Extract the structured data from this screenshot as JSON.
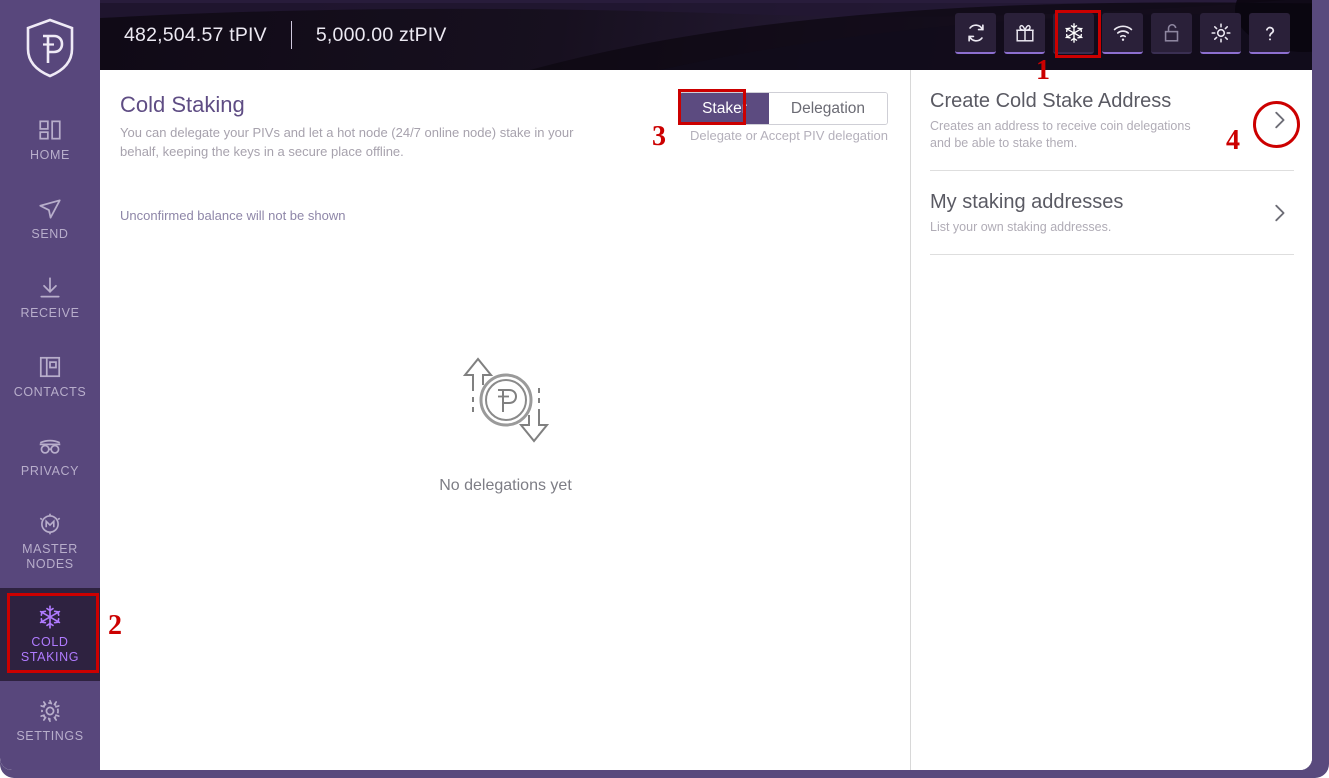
{
  "window": {
    "frame_color": "#594a7d",
    "sidebar_color": "#58477c",
    "accent_color": "#b07bff",
    "annotation_color": "#cc0000"
  },
  "sidebar": {
    "logo_name": "pivx-shield-logo",
    "items": [
      {
        "id": "home",
        "label": "HOME",
        "icon": "dashboard-icon",
        "active": false
      },
      {
        "id": "send",
        "label": "SEND",
        "icon": "send-icon",
        "active": false
      },
      {
        "id": "receive",
        "label": "RECEIVE",
        "icon": "receive-icon",
        "active": false
      },
      {
        "id": "contacts",
        "label": "CONTACTS",
        "icon": "contacts-icon",
        "active": false
      },
      {
        "id": "privacy",
        "label": "PRIVACY",
        "icon": "privacy-mask-icon",
        "active": false
      },
      {
        "id": "masternodes",
        "label": "MASTER\nNODES",
        "icon": "masternode-icon",
        "active": false
      },
      {
        "id": "coldstaking",
        "label": "COLD\nSTAKING",
        "icon": "snowflake-icon",
        "active": true
      },
      {
        "id": "settings",
        "label": "SETTINGS",
        "icon": "gear-icon",
        "active": false
      }
    ]
  },
  "header": {
    "balance_primary": "482,504.57 tPIV",
    "balance_secondary": "5,000.00 ztPIV",
    "toolbar": [
      {
        "id": "sync",
        "name": "sync-refresh-icon",
        "title": "Sync",
        "highlighted": false
      },
      {
        "id": "gift",
        "name": "gift-icon",
        "title": "Gift",
        "highlighted": false
      },
      {
        "id": "coldstake",
        "name": "snowflake-icon",
        "title": "Cold Staking",
        "highlighted": true
      },
      {
        "id": "connection",
        "name": "wifi-icon",
        "title": "Connection",
        "highlighted": false
      },
      {
        "id": "lock",
        "name": "unlock-icon",
        "title": "Unlock",
        "highlighted": false
      },
      {
        "id": "theme",
        "name": "sun-icon",
        "title": "Theme",
        "highlighted": false
      },
      {
        "id": "help",
        "name": "help-icon",
        "title": "Help",
        "highlighted": false
      }
    ]
  },
  "main": {
    "title": "Cold Staking",
    "subtitle": "You can delegate your PIVs and let a hot node (24/7 online node) stake in your behalf, keeping the keys in a secure place offline.",
    "unconfirmed_notice": "Unconfirmed balance will not be shown",
    "tabs": [
      {
        "id": "staker",
        "label": "Staker",
        "active": true
      },
      {
        "id": "delegation",
        "label": "Delegation",
        "active": false
      }
    ],
    "tabs_subtitle": "Delegate or Accept PIV delegation",
    "empty_state": {
      "illustration": "pivx-coin-exchange-arrows-icon",
      "text": "No delegations yet"
    }
  },
  "right_panel": {
    "rows": [
      {
        "id": "create-cold-stake-address",
        "title": "Create Cold Stake Address",
        "desc": "Creates an address to receive coin delegations and be able to stake them.",
        "chevron": "chevron-right-icon"
      },
      {
        "id": "my-staking-addresses",
        "title": "My staking addresses",
        "desc": "List your own staking addresses.",
        "chevron": "chevron-right-icon"
      }
    ]
  },
  "annotations": [
    {
      "id": "1",
      "label": "1",
      "target": "header-toolbar-snowflake-button"
    },
    {
      "id": "2",
      "label": "2",
      "target": "sidebar-item-coldstaking"
    },
    {
      "id": "3",
      "label": "3",
      "target": "tab-staker"
    },
    {
      "id": "4",
      "label": "4",
      "target": "create-cold-stake-address-chevron"
    }
  ]
}
